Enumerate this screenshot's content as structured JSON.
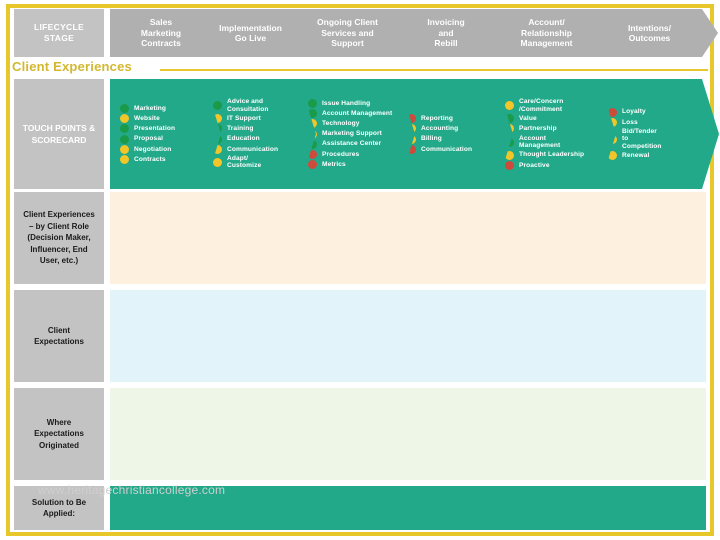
{
  "slide": {
    "section_title": "Client Experiences",
    "watermark": "www.heritagechristiancollege.com"
  },
  "colors": {
    "frame": "#e8c72a",
    "stage_header_first": "#c3c3c3",
    "stage_header": "#b0b0b0",
    "touchpoint_band": "#22A98A",
    "dot_green": "#199B4A",
    "dot_yellow": "#F2C528",
    "dot_red": "#CE4B3C",
    "row_client_experiences": "#FDF0DF",
    "row_client_expectations": "#E2F4FA",
    "row_where_originated": "#EEF6E7",
    "row_solution": "#22A98A",
    "row_header": "#c3c3c3",
    "title_gold": "#d4b830"
  },
  "lifecycle": {
    "header_label": "LIFECYCLE STAGE",
    "stages": [
      {
        "label": "Sales\nMarketing\nContracts"
      },
      {
        "label": "Implementation\nGo Live"
      },
      {
        "label": "Ongoing Client\nServices and\nSupport"
      },
      {
        "label": "Invoicing\nand\nRebill"
      },
      {
        "label": "Account/\nRelationship\nManagement"
      },
      {
        "label": "Intentions/\nOutcomes"
      }
    ]
  },
  "touchpoints": {
    "header_label": "TOUCH POINTS &\nSCORECARD",
    "columns": [
      {
        "items": [
          {
            "label": "Marketing",
            "color": "green"
          },
          {
            "label": "Website",
            "color": "yellow"
          },
          {
            "label": "Presentation",
            "color": "green"
          },
          {
            "label": "Proposal",
            "color": "green"
          },
          {
            "label": "Negotiation",
            "color": "yellow"
          },
          {
            "label": "Contracts",
            "color": "yellow"
          }
        ]
      },
      {
        "items": [
          {
            "label": "Advice and\nConsultation",
            "color": "green"
          },
          {
            "label": "IT Support",
            "color": "yellow"
          },
          {
            "label": "Training",
            "color": "green"
          },
          {
            "label": "Education",
            "color": "green"
          },
          {
            "label": "Communication",
            "color": "yellow"
          },
          {
            "label": "Adapt/\nCustomize",
            "color": "yellow"
          }
        ]
      },
      {
        "items": [
          {
            "label": "Issue Handling",
            "color": "green"
          },
          {
            "label": "Account Management",
            "color": "green"
          },
          {
            "label": "Technology",
            "color": "yellow"
          },
          {
            "label": "Marketing Support",
            "color": "yellow"
          },
          {
            "label": "Assistance Center",
            "color": "green"
          },
          {
            "label": "Procedures",
            "color": "red"
          },
          {
            "label": "Metrics",
            "color": "red"
          }
        ]
      },
      {
        "items": [
          {
            "label": "Reporting",
            "color": "red"
          },
          {
            "label": "Accounting",
            "color": "yellow"
          },
          {
            "label": "Billing",
            "color": "yellow"
          },
          {
            "label": "Communication",
            "color": "red"
          }
        ]
      },
      {
        "items": [
          {
            "label": "Care/Concern\n/Commitment",
            "color": "yellow"
          },
          {
            "label": "Value",
            "color": "green"
          },
          {
            "label": "Partnership",
            "color": "yellow"
          },
          {
            "label": "Account\nManagement",
            "color": "green"
          },
          {
            "label": "Thought Leadership",
            "color": "yellow"
          },
          {
            "label": "Proactive",
            "color": "red"
          }
        ]
      },
      {
        "items": [
          {
            "label": "Loyalty",
            "color": "red"
          },
          {
            "label": "Loss",
            "color": "yellow"
          },
          {
            "label": "Bid/Tender\nto\nCompetition",
            "color": "yellow"
          },
          {
            "label": "Renewal",
            "color": "yellow"
          }
        ]
      }
    ]
  },
  "matrix": {
    "rows": [
      {
        "header": "Client Experiences\n– by Client Role\n(Decision Maker,\nInfluencer, End\nUser, etc.)",
        "fill": "#FDF0DF",
        "cells": [
          "",
          "",
          "",
          "",
          "",
          ""
        ]
      },
      {
        "header": "Client\nExpectations",
        "fill": "#E2F4FA",
        "cells": [
          "",
          "",
          "",
          "",
          "",
          ""
        ]
      },
      {
        "header": "Where\nExpectations\nOriginated",
        "fill": "#EEF6E7",
        "cells": [
          "",
          "",
          "",
          "",
          "",
          ""
        ]
      },
      {
        "header": "Solution to Be\nApplied:",
        "fill": "#22A98A",
        "cells": [
          "",
          "",
          "",
          "",
          "",
          ""
        ]
      }
    ]
  }
}
